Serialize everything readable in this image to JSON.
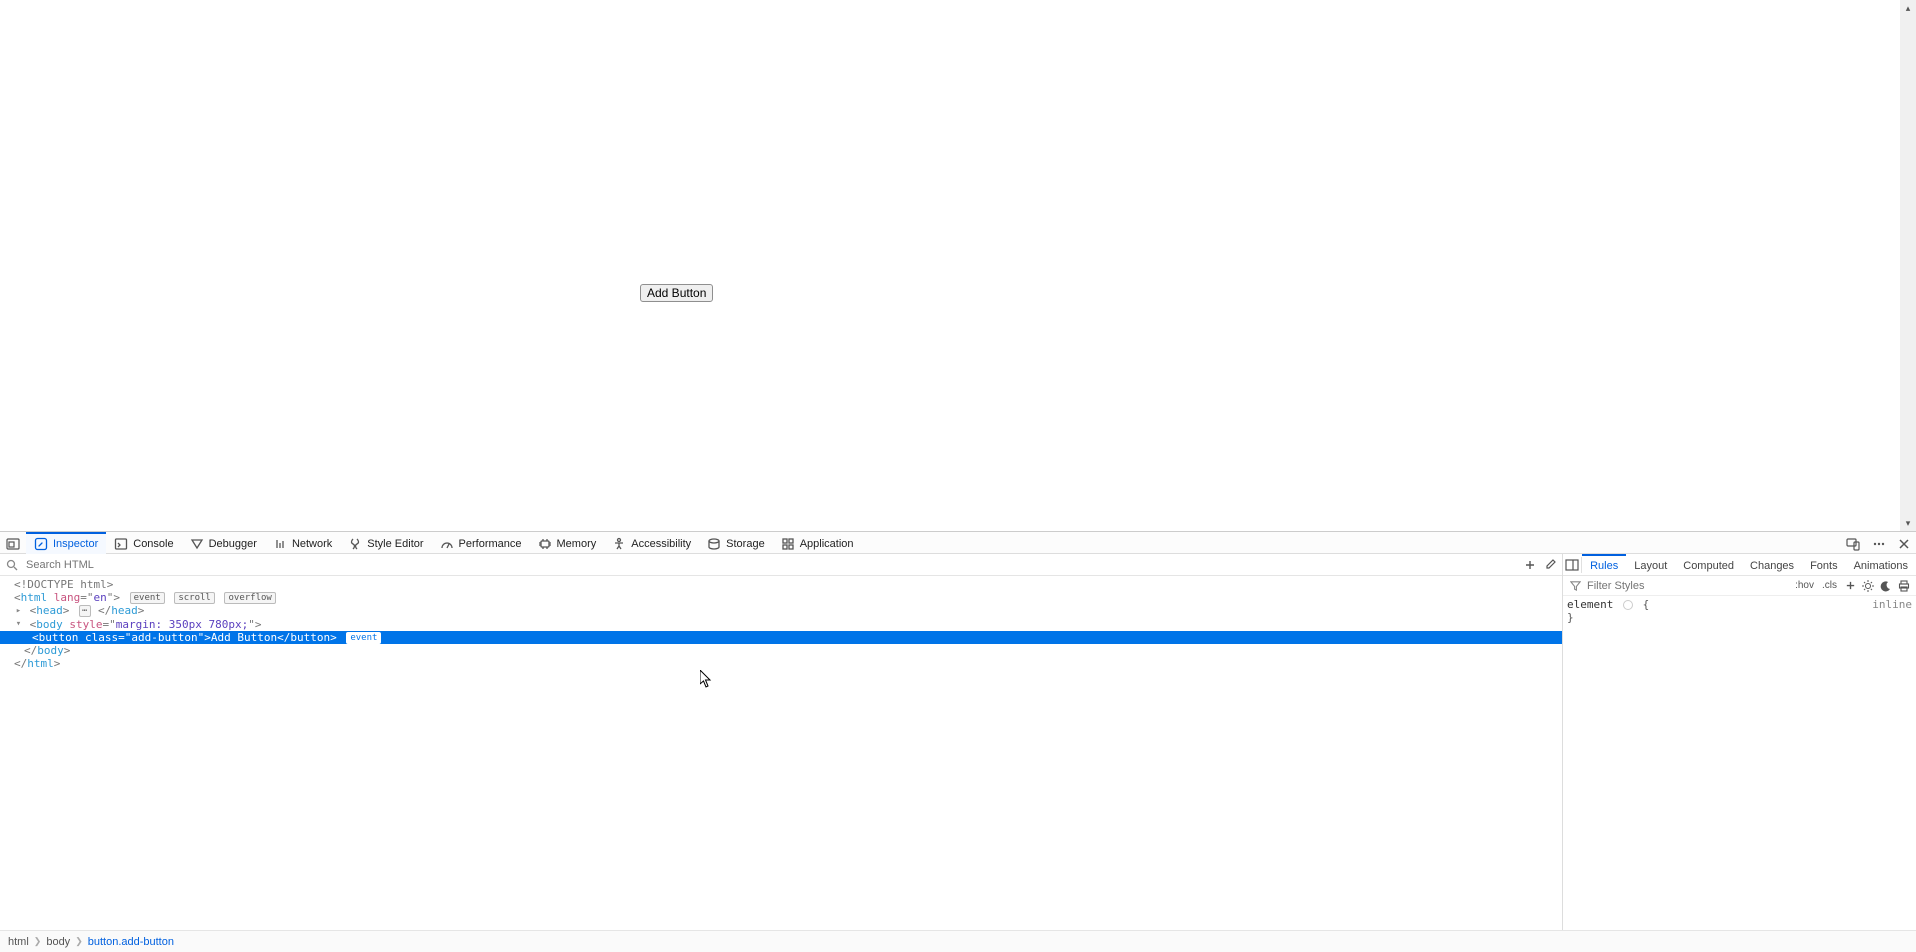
{
  "page": {
    "button_label": "Add Button"
  },
  "devtools": {
    "tabs": {
      "inspector": "Inspector",
      "console": "Console",
      "debugger": "Debugger",
      "network": "Network",
      "style_editor": "Style Editor",
      "performance": "Performance",
      "memory": "Memory",
      "accessibility": "Accessibility",
      "storage": "Storage",
      "application": "Application"
    },
    "search_placeholder": "Search HTML",
    "dom": {
      "line0": "<!DOCTYPE html>",
      "html_tag": "html",
      "html_attr_name": "lang",
      "html_attr_value": "en",
      "badge_event": "event",
      "badge_scroll": "scroll",
      "badge_overflow": "overflow",
      "head_tag": "head",
      "body_tag": "body",
      "body_attr_name": "style",
      "body_attr_value": "margin: 350px 780px;",
      "button_tag_open": "<button ",
      "button_class_attr": "class",
      "button_class_value": "add-button",
      "button_text": "Add Button",
      "button_tag_close": "</button>",
      "body_close": "</",
      "html_close": "</"
    },
    "breadcrumbs": {
      "c0": "html",
      "c1": "body",
      "c2": "button.add-button"
    }
  },
  "styles": {
    "tabs": {
      "rules": "Rules",
      "layout": "Layout",
      "computed": "Computed",
      "changes": "Changes",
      "fonts": "Fonts",
      "animations": "Animations"
    },
    "filter_placeholder": "Filter Styles",
    "hov": ":hov",
    "cls": ".cls",
    "rule_selector": "element",
    "rule_brace_open": "{",
    "rule_brace_close": "}",
    "inline_label": "inline"
  }
}
